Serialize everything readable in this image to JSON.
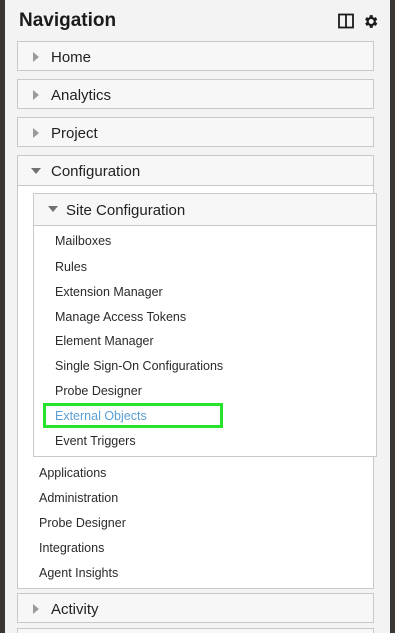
{
  "panel": {
    "title": "Navigation",
    "tools": [
      {
        "icon": "split-panel-icon"
      },
      {
        "icon": "gear-icon"
      }
    ]
  },
  "sections": [
    {
      "label": "Home",
      "expanded": false
    },
    {
      "label": "Analytics",
      "expanded": false
    },
    {
      "label": "Project",
      "expanded": false
    },
    {
      "label": "Configuration",
      "expanded": true
    },
    {
      "label": "Activity",
      "expanded": false
    }
  ],
  "configuration": {
    "site_configuration": {
      "label": "Site Configuration",
      "expanded": true,
      "items": [
        "Mailboxes",
        "Rules",
        "Extension Manager",
        "Manage Access Tokens",
        "Element Manager",
        "Single Sign-On Configurations",
        "Probe Designer",
        "External Objects",
        "Event Triggers"
      ],
      "active_item": "External Objects"
    },
    "items": [
      "Applications",
      "Administration",
      "Probe Designer",
      "Integrations",
      "Agent Insights"
    ]
  },
  "colors": {
    "active_link": "#5a9fd4",
    "highlight_box": "#27e32c"
  }
}
